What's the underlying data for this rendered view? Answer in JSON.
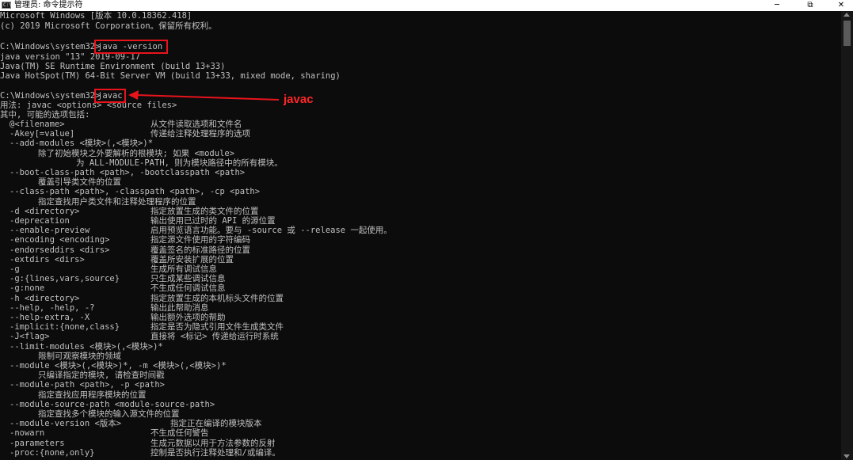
{
  "window": {
    "title": "管理员: 命令提示符",
    "icon_text": "C:\\",
    "minimize_glyph": "─",
    "maximize_glyph": "⧉",
    "close_glyph": "✕"
  },
  "annotation": {
    "label": "javac",
    "color": "#e8141c"
  },
  "console": {
    "header": [
      "Microsoft Windows [版本 10.0.18362.418]",
      "(c) 2019 Microsoft Corporation。保留所有权利。"
    ],
    "prompt": "C:\\Windows\\system32>",
    "cmd1": "java -version",
    "version_lines": [
      "java version \"13\" 2019-09-17",
      "Java(TM) SE Runtime Environment (build 13+33)",
      "Java HotSpot(TM) 64-Bit Server VM (build 13+33, mixed mode, sharing)"
    ],
    "cmd2": "javac",
    "usage": "用法: javac <options> <source files>",
    "options_header": "其中, 可能的选项包括:",
    "options": [
      {
        "opt": "@<filename>",
        "desc": "从文件读取选项和文件名"
      },
      {
        "opt": "-Akey[=value]",
        "desc": "传递给注释处理程序的选项"
      },
      {
        "opt": "--add-modules <模块>(,<模块>)*",
        "desc": ""
      },
      {
        "sub": "除了初始模块之外要解析的根模块; 如果 <module>",
        "level": 2
      },
      {
        "sub": "为 ALL-MODULE-PATH, 则为模块路径中的所有模块。",
        "level": 3
      },
      {
        "opt": "--boot-class-path <path>, -bootclasspath <path>",
        "desc": ""
      },
      {
        "sub": "覆盖引导类文件的位置",
        "level": 2
      },
      {
        "opt": "--class-path <path>, -classpath <path>, -cp <path>",
        "desc": ""
      },
      {
        "sub": "指定查找用户类文件和注释处理程序的位置",
        "level": 2
      },
      {
        "opt": "-d <directory>",
        "desc": "指定放置生成的类文件的位置"
      },
      {
        "opt": "-deprecation",
        "desc": "输出使用已过时的 API 的源位置"
      },
      {
        "opt": "--enable-preview",
        "desc": "启用预览语言功能。要与 -source 或 --release 一起使用。"
      },
      {
        "opt": "-encoding <encoding>",
        "desc": "指定源文件使用的字符编码"
      },
      {
        "opt": "-endorseddirs <dirs>",
        "desc": "覆盖签名的标准路径的位置"
      },
      {
        "opt": "-extdirs <dirs>",
        "desc": "覆盖所安装扩展的位置"
      },
      {
        "opt": "-g",
        "desc": "生成所有调试信息"
      },
      {
        "opt": "-g:{lines,vars,source}",
        "desc": "只生成某些调试信息"
      },
      {
        "opt": "-g:none",
        "desc": "不生成任何调试信息"
      },
      {
        "opt": "-h <directory>",
        "desc": "指定放置生成的本机标头文件的位置"
      },
      {
        "opt": "--help, -help, -?",
        "desc": "输出此帮助消息"
      },
      {
        "opt": "--help-extra, -X",
        "desc": "输出额外选项的帮助"
      },
      {
        "opt": "-implicit:{none,class}",
        "desc": "指定是否为隐式引用文件生成类文件"
      },
      {
        "opt": "-J<flag>",
        "desc": "直接将 <标记> 传递给运行时系统"
      },
      {
        "opt": "--limit-modules <模块>(,<模块>)*",
        "desc": ""
      },
      {
        "sub": "限制可观察模块的领域",
        "level": 2
      },
      {
        "opt": "--module <模块>(,<模块>)*, -m <模块>(,<模块>)*",
        "desc": ""
      },
      {
        "sub": "只编译指定的模块, 请检查时间戳",
        "level": 2
      },
      {
        "opt": "--module-path <path>, -p <path>",
        "desc": ""
      },
      {
        "sub": "指定查找应用程序模块的位置",
        "level": 2
      },
      {
        "opt": "--module-source-path <module-source-path>",
        "desc": ""
      },
      {
        "sub": "指定查找多个模块的输入源文件的位置",
        "level": 2
      },
      {
        "opt": "--module-version <版本>",
        "desc": "指定正在编译的模块版本",
        "alt": true
      },
      {
        "opt": "-nowarn",
        "desc": "不生成任何警告"
      },
      {
        "opt": "-parameters",
        "desc": "生成元数据以用于方法参数的反射"
      },
      {
        "opt": "-proc:{none,only}",
        "desc": "控制是否执行注释处理和/或编译。"
      }
    ]
  }
}
